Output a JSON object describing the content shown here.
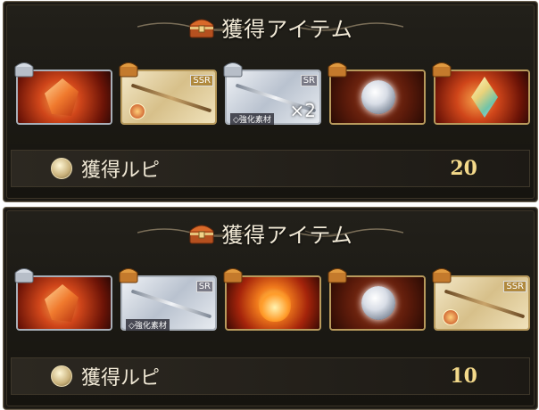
{
  "panels": [
    {
      "title": "獲得アイテム",
      "items": [
        {
          "icon": "fire-crystal-icon",
          "frame": "silver",
          "art": "red",
          "badge": "silver-chest-icon",
          "rarity": "",
          "tag": "",
          "qty": ""
        },
        {
          "icon": "staff-weapon-icon",
          "frame": "gold",
          "art": "gold",
          "badge": "gold-chest-icon",
          "rarity": "SSR",
          "tag": "",
          "qty": ""
        },
        {
          "icon": "silver-staff-icon",
          "frame": "silver",
          "art": "silver",
          "badge": "silver-chest-icon",
          "rarity": "SR",
          "tag": "◇強化素材",
          "qty": "×2"
        },
        {
          "icon": "orb-icon",
          "frame": "gold",
          "art": "brown",
          "badge": "gold-chest-icon",
          "rarity": "",
          "tag": "",
          "qty": ""
        },
        {
          "icon": "gem-icon",
          "frame": "gold",
          "art": "red",
          "badge": "gold-chest-icon",
          "rarity": "",
          "tag": "",
          "qty": ""
        }
      ],
      "rupie_label": "獲得ルピ",
      "rupie_amount": "20"
    },
    {
      "title": "獲得アイテム",
      "items": [
        {
          "icon": "fire-crystal-icon",
          "frame": "silver",
          "art": "red",
          "badge": "silver-chest-icon",
          "rarity": "",
          "tag": "",
          "qty": ""
        },
        {
          "icon": "silver-staff-icon",
          "frame": "silver",
          "art": "silver",
          "badge": "gold-chest-icon",
          "rarity": "SR",
          "tag": "◇強化素材",
          "qty": ""
        },
        {
          "icon": "fire-emblem-icon",
          "frame": "gold",
          "art": "fire",
          "badge": "gold-chest-icon",
          "rarity": "",
          "tag": "",
          "qty": ""
        },
        {
          "icon": "orb-icon",
          "frame": "gold",
          "art": "brown",
          "badge": "gold-chest-icon",
          "rarity": "",
          "tag": "",
          "qty": ""
        },
        {
          "icon": "staff-weapon-icon",
          "frame": "gold",
          "art": "gold",
          "badge": "gold-chest-icon",
          "rarity": "SSR",
          "tag": "",
          "qty": ""
        }
      ],
      "rupie_label": "獲得ルピ",
      "rupie_amount": "10"
    }
  ],
  "colors": {
    "panel_bg": "#1c1914",
    "title_text": "#f2ead7",
    "amount_text": "#f3d98a",
    "gold_frame": "#b89a5c",
    "silver_frame": "#a8afb8"
  }
}
